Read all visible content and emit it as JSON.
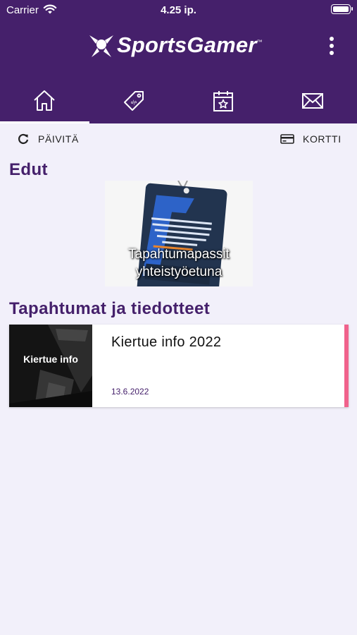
{
  "status_bar": {
    "carrier": "Carrier",
    "time": "4.25 ip."
  },
  "header": {
    "logo_text": "SportsGamer",
    "logo_tm": "™",
    "menu_icon": "more-vertical-icon"
  },
  "tabs": [
    {
      "icon": "home-icon",
      "active": true
    },
    {
      "icon": "tag-icon",
      "active": false
    },
    {
      "icon": "calendar-star-icon",
      "active": false
    },
    {
      "icon": "mail-icon",
      "active": false
    }
  ],
  "actions": {
    "refresh_label": "PÄIVITÄ",
    "refresh_icon": "refresh-icon",
    "card_label": "KORTTI",
    "card_icon": "credit-card-icon"
  },
  "benefits": {
    "title": "Edut",
    "items": [
      {
        "caption_line1": "Tapahtumapassit",
        "caption_line2": "yhteistyöetuna"
      }
    ]
  },
  "news": {
    "title": "Tapahtumat ja tiedotteet",
    "items": [
      {
        "thumb_label": "Kiertue info",
        "title": "Kiertue info 2022",
        "date": "13.6.2022"
      }
    ]
  },
  "colors": {
    "brand_purple": "#45206b",
    "background": "#f2f0fa",
    "accent_pink": "#f0628c"
  }
}
